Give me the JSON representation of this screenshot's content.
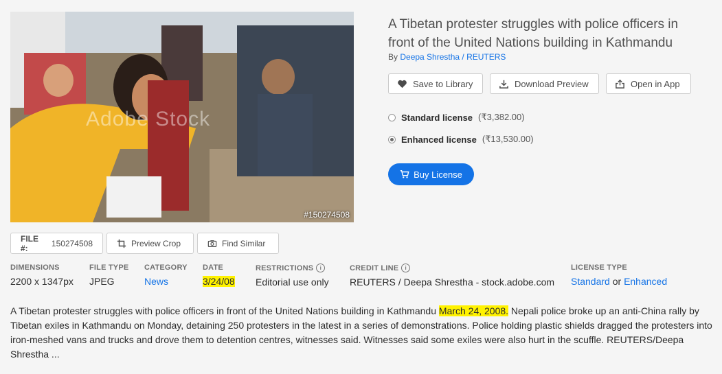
{
  "image": {
    "title": "A Tibetan protester struggles with police officers in front of the United Nations building in Kathmandu",
    "photo_id": "#150274508",
    "watermark": "Adobe Stock",
    "byline_prefix": "By",
    "author": "Deepa Shrestha / REUTERS"
  },
  "actions": {
    "save": "Save to Library",
    "download": "Download Preview",
    "open": "Open in App"
  },
  "licenses": [
    {
      "name": "Standard license",
      "price": "(₹3,382.00)",
      "selected": false
    },
    {
      "name": "Enhanced license",
      "price": "(₹13,530.00)",
      "selected": true
    }
  ],
  "buy_label": "Buy License",
  "file": {
    "label": "FILE #:",
    "number": "150274508",
    "preview_crop": "Preview Crop",
    "find_similar": "Find Similar"
  },
  "meta": {
    "dimensions_label": "DIMENSIONS",
    "dimensions": "2200 x 1347px",
    "filetype_label": "FILE TYPE",
    "filetype": "JPEG",
    "category_label": "CATEGORY",
    "category": "News",
    "date_label": "DATE",
    "date": "3/24/08",
    "restrictions_label": "RESTRICTIONS",
    "restrictions": "Editorial use only",
    "credit_label": "CREDIT LINE",
    "credit": "REUTERS / Deepa Shrestha - stock.adobe.com",
    "license_type_label": "LICENSE TYPE",
    "license_standard": "Standard",
    "license_or": "or",
    "license_enhanced": "Enhanced"
  },
  "description": {
    "part1": "A Tibetan protester struggles with police officers in front of the United Nations building in Kathmandu ",
    "highlight": "March 24, 2008.",
    "part2": " Nepali police broke up an anti-China rally by Tibetan exiles in Kathmandu on Monday, detaining 250 protesters in the latest in a series of demonstrations. Police holding plastic shields dragged the protesters into iron-meshed vans and trucks and drove them to detention centres, witnesses said. Witnesses said some exiles were also hurt in the scuffle. REUTERS/Deepa Shrestha ..."
  },
  "colors": {
    "accent": "#1473e6",
    "highlight": "#fff200"
  }
}
